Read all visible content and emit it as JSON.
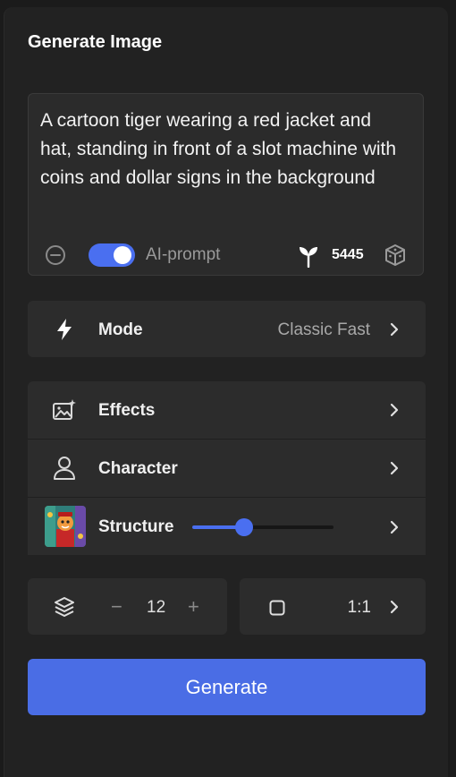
{
  "panel": {
    "title": "Generate Image"
  },
  "prompt": {
    "text": "A cartoon tiger wearing a red jacket and hat, standing in front of a slot machine with coins and dollar signs in the background",
    "ai_prompt_label": "AI-prompt",
    "ai_prompt_enabled": true,
    "credits": "5445",
    "icons": [
      "minus-circle-icon",
      "sprout-icon",
      "dice-icon"
    ]
  },
  "mode": {
    "label": "Mode",
    "value": "Classic Fast",
    "icon": "lightning-icon"
  },
  "effects": {
    "label": "Effects",
    "icon": "image-sparkle-icon"
  },
  "character": {
    "label": "Character",
    "icon": "person-icon"
  },
  "structure": {
    "label": "Structure",
    "strength": 0.37
  },
  "count": {
    "minus": "−",
    "value": "12",
    "plus": "+",
    "icon": "layers-icon"
  },
  "aspect": {
    "value": "1:1",
    "icon": "square-icon"
  },
  "generate": {
    "label": "Generate"
  },
  "colors": {
    "accent": "#4a6de5",
    "panel": "#222222",
    "card": "#2c2c2c"
  }
}
